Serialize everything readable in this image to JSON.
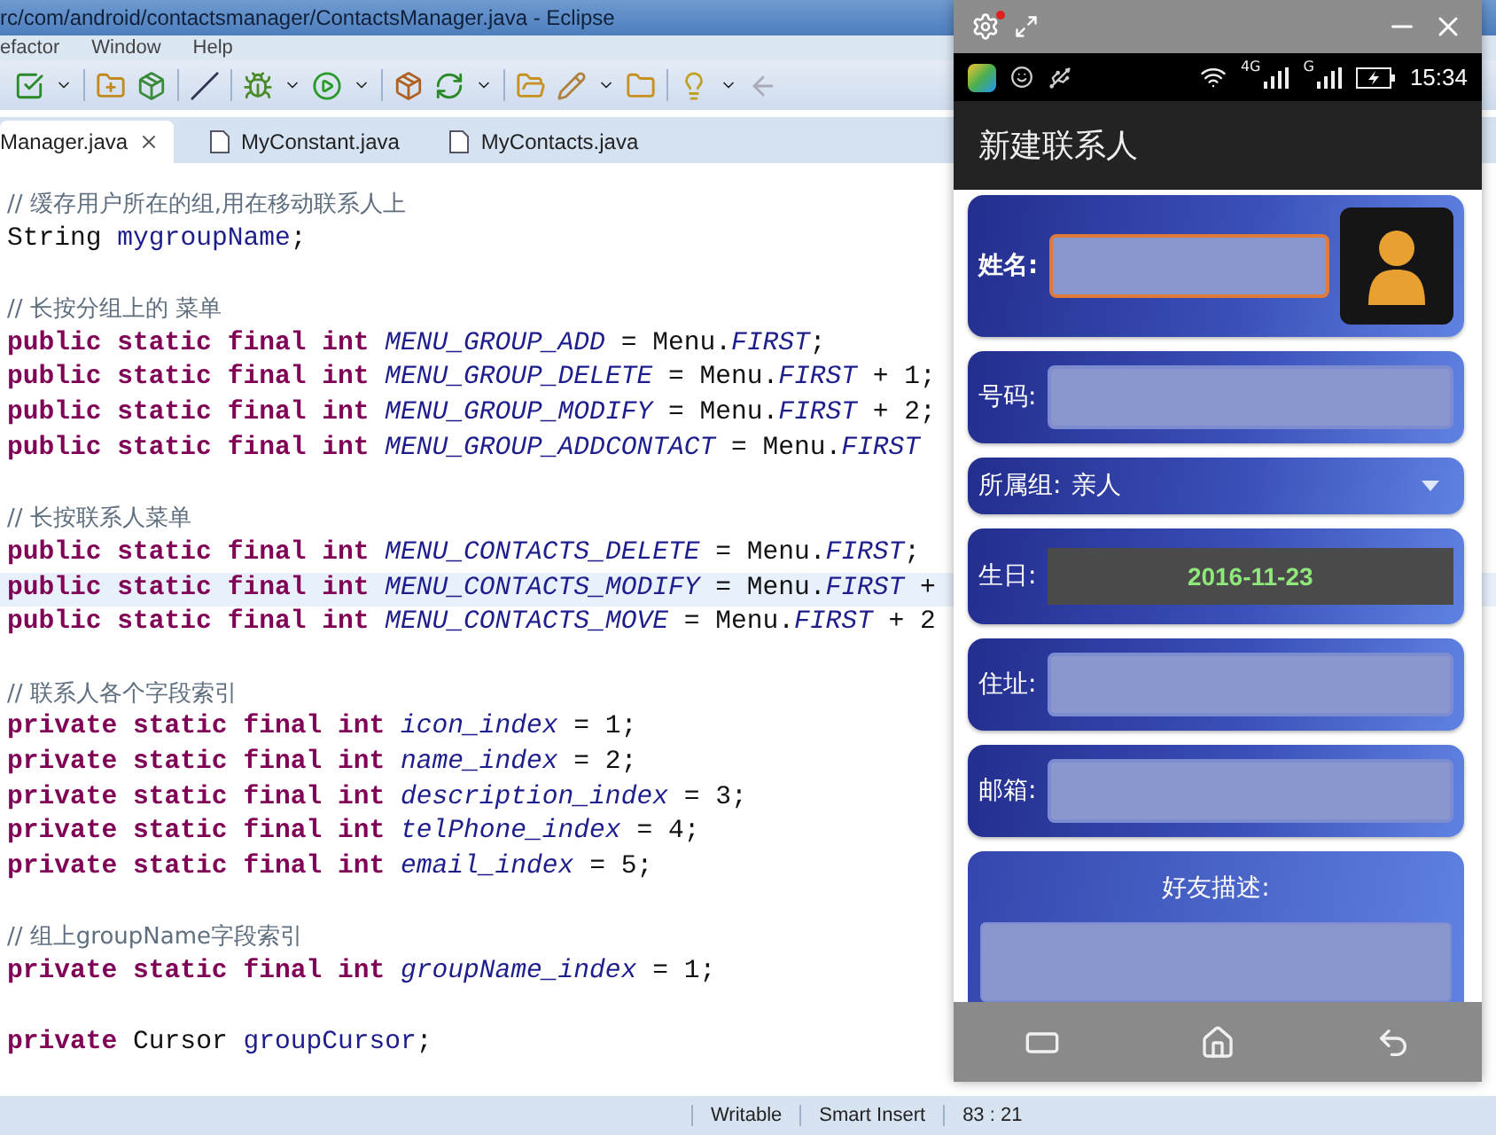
{
  "ide": {
    "title": "rc/com/android/contactsmanager/ContactsManager.java - Eclipse",
    "menu": [
      "efactor",
      "Window",
      "Help"
    ],
    "tabs": [
      {
        "label": "Manager.java",
        "selected": true
      },
      {
        "label": "MyConstant.java",
        "selected": false
      },
      {
        "label": "MyContacts.java",
        "selected": false
      }
    ],
    "code_lines": [
      {
        "kind": "code",
        "highlighted": false,
        "tokens": [
          {
            "kind": "comment",
            "text": "// 缓存用户所在的组,用在移动联系人上"
          }
        ]
      },
      {
        "kind": "code",
        "highlighted": false,
        "tokens": [
          {
            "kind": "plain",
            "text": "String "
          },
          {
            "kind": "field",
            "text": "mygroupName"
          },
          {
            "kind": "plain",
            "text": ";"
          }
        ]
      },
      {
        "kind": "blank"
      },
      {
        "kind": "code",
        "highlighted": false,
        "tokens": [
          {
            "kind": "comment",
            "text": "// 长按分组上的 菜单"
          }
        ]
      },
      {
        "kind": "code",
        "highlighted": false,
        "tokens": [
          {
            "kind": "keyword",
            "text": "public static final int "
          },
          {
            "kind": "static_field",
            "text": "MENU_GROUP_ADD"
          },
          {
            "kind": "plain",
            "text": " = Menu."
          },
          {
            "kind": "static_field",
            "text": "FIRST"
          },
          {
            "kind": "plain",
            "text": ";"
          }
        ]
      },
      {
        "kind": "code",
        "highlighted": false,
        "tokens": [
          {
            "kind": "keyword",
            "text": "public static final int "
          },
          {
            "kind": "static_field",
            "text": "MENU_GROUP_DELETE"
          },
          {
            "kind": "plain",
            "text": " = Menu."
          },
          {
            "kind": "static_field",
            "text": "FIRST"
          },
          {
            "kind": "plain",
            "text": " + 1;"
          }
        ]
      },
      {
        "kind": "code",
        "highlighted": false,
        "tokens": [
          {
            "kind": "keyword",
            "text": "public static final int "
          },
          {
            "kind": "static_field",
            "text": "MENU_GROUP_MODIFY"
          },
          {
            "kind": "plain",
            "text": " = Menu."
          },
          {
            "kind": "static_field",
            "text": "FIRST"
          },
          {
            "kind": "plain",
            "text": " + 2;"
          }
        ]
      },
      {
        "kind": "code",
        "highlighted": false,
        "tokens": [
          {
            "kind": "keyword",
            "text": "public static final int "
          },
          {
            "kind": "static_field",
            "text": "MENU_GROUP_ADDCONTACT"
          },
          {
            "kind": "plain",
            "text": " = Menu."
          },
          {
            "kind": "static_field",
            "text": "FIRST"
          }
        ]
      },
      {
        "kind": "blank"
      },
      {
        "kind": "code",
        "highlighted": false,
        "tokens": [
          {
            "kind": "comment",
            "text": "// 长按联系人菜单"
          }
        ]
      },
      {
        "kind": "code",
        "highlighted": false,
        "tokens": [
          {
            "kind": "keyword",
            "text": "public static final int "
          },
          {
            "kind": "static_field",
            "text": "MENU_CONTACTS_DELETE"
          },
          {
            "kind": "plain",
            "text": " = Menu."
          },
          {
            "kind": "static_field",
            "text": "FIRST"
          },
          {
            "kind": "plain",
            "text": ";"
          }
        ]
      },
      {
        "kind": "code",
        "highlighted": true,
        "tokens": [
          {
            "kind": "keyword",
            "text": "public static final int "
          },
          {
            "kind": "static_field",
            "text": "MENU_CONTACTS_MODIFY"
          },
          {
            "kind": "plain",
            "text": " = Menu."
          },
          {
            "kind": "static_field",
            "text": "FIRST"
          },
          {
            "kind": "plain",
            "text": " +"
          }
        ]
      },
      {
        "kind": "code",
        "highlighted": false,
        "tokens": [
          {
            "kind": "keyword",
            "text": "public static final int "
          },
          {
            "kind": "static_field",
            "text": "MENU_CONTACTS_MOVE"
          },
          {
            "kind": "plain",
            "text": " = Menu."
          },
          {
            "kind": "static_field",
            "text": "FIRST"
          },
          {
            "kind": "plain",
            "text": " + 2"
          }
        ]
      },
      {
        "kind": "blank"
      },
      {
        "kind": "code",
        "highlighted": false,
        "tokens": [
          {
            "kind": "comment",
            "text": "// 联系人各个字段索引"
          }
        ]
      },
      {
        "kind": "code",
        "highlighted": false,
        "tokens": [
          {
            "kind": "keyword",
            "text": "private static final int "
          },
          {
            "kind": "static_field",
            "text": "icon_index"
          },
          {
            "kind": "plain",
            "text": " = 1;"
          }
        ]
      },
      {
        "kind": "code",
        "highlighted": false,
        "tokens": [
          {
            "kind": "keyword",
            "text": "private static final int "
          },
          {
            "kind": "static_field",
            "text": "name_index"
          },
          {
            "kind": "plain",
            "text": " = 2;"
          }
        ]
      },
      {
        "kind": "code",
        "highlighted": false,
        "tokens": [
          {
            "kind": "keyword",
            "text": "private static final int "
          },
          {
            "kind": "static_field",
            "text": "description_index"
          },
          {
            "kind": "plain",
            "text": " = 3;"
          }
        ]
      },
      {
        "kind": "code",
        "highlighted": false,
        "tokens": [
          {
            "kind": "keyword",
            "text": "private static final int "
          },
          {
            "kind": "static_field",
            "text": "telPhone_index"
          },
          {
            "kind": "plain",
            "text": " = 4;"
          }
        ]
      },
      {
        "kind": "code",
        "highlighted": false,
        "tokens": [
          {
            "kind": "keyword",
            "text": "private static final int "
          },
          {
            "kind": "static_field",
            "text": "email_index"
          },
          {
            "kind": "plain",
            "text": " = 5;"
          }
        ]
      },
      {
        "kind": "blank"
      },
      {
        "kind": "code",
        "highlighted": false,
        "tokens": [
          {
            "kind": "comment",
            "text": "// 组上groupName字段索引"
          }
        ]
      },
      {
        "kind": "code",
        "highlighted": false,
        "tokens": [
          {
            "kind": "keyword",
            "text": "private static final int "
          },
          {
            "kind": "static_field",
            "text": "groupName_index"
          },
          {
            "kind": "plain",
            "text": " = 1;"
          }
        ]
      },
      {
        "kind": "blank"
      },
      {
        "kind": "code",
        "highlighted": false,
        "tokens": [
          {
            "kind": "keyword",
            "text": "private "
          },
          {
            "kind": "plain",
            "text": "Cursor "
          },
          {
            "kind": "field",
            "text": "groupCursor"
          },
          {
            "kind": "plain",
            "text": ";"
          }
        ]
      }
    ],
    "status_bar": [
      "Writable",
      "Smart Insert",
      "83 : 21"
    ]
  },
  "phone": {
    "clock": "15:34",
    "signal_labels": [
      "4G",
      "G"
    ],
    "app_title": "新建联系人",
    "fields": [
      {
        "kind": "name",
        "label": "姓名:",
        "focused": true
      },
      {
        "kind": "text",
        "label": "号码:",
        "focused": false
      },
      {
        "kind": "select",
        "label": "所属组:",
        "value": "亲人"
      },
      {
        "kind": "date",
        "label": "生日:",
        "value": "2016-11-23"
      },
      {
        "kind": "text",
        "label": "住址:",
        "focused": false
      },
      {
        "kind": "text",
        "label": "邮箱:",
        "focused": false
      },
      {
        "kind": "textarea",
        "label": "好友描述:"
      }
    ]
  }
}
